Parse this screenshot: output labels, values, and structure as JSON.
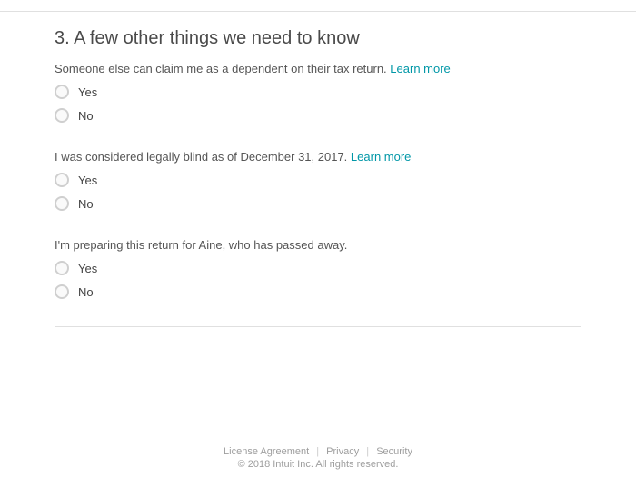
{
  "section": {
    "number": "3.",
    "title": "A few other things we need to know"
  },
  "questions": [
    {
      "text": "Someone else can claim me as a dependent on their tax return.",
      "learn_more": "Learn more",
      "yes": "Yes",
      "no": "No"
    },
    {
      "text": "I was considered legally blind as of December 31, 2017.",
      "learn_more": "Learn more",
      "yes": "Yes",
      "no": "No"
    },
    {
      "text": "I'm preparing this return for Aine, who has passed away.",
      "learn_more": "",
      "yes": "Yes",
      "no": "No"
    }
  ],
  "footer": {
    "license": "License Agreement",
    "privacy": "Privacy",
    "security": "Security",
    "copyright": "© 2018 Intuit Inc. All rights reserved."
  }
}
